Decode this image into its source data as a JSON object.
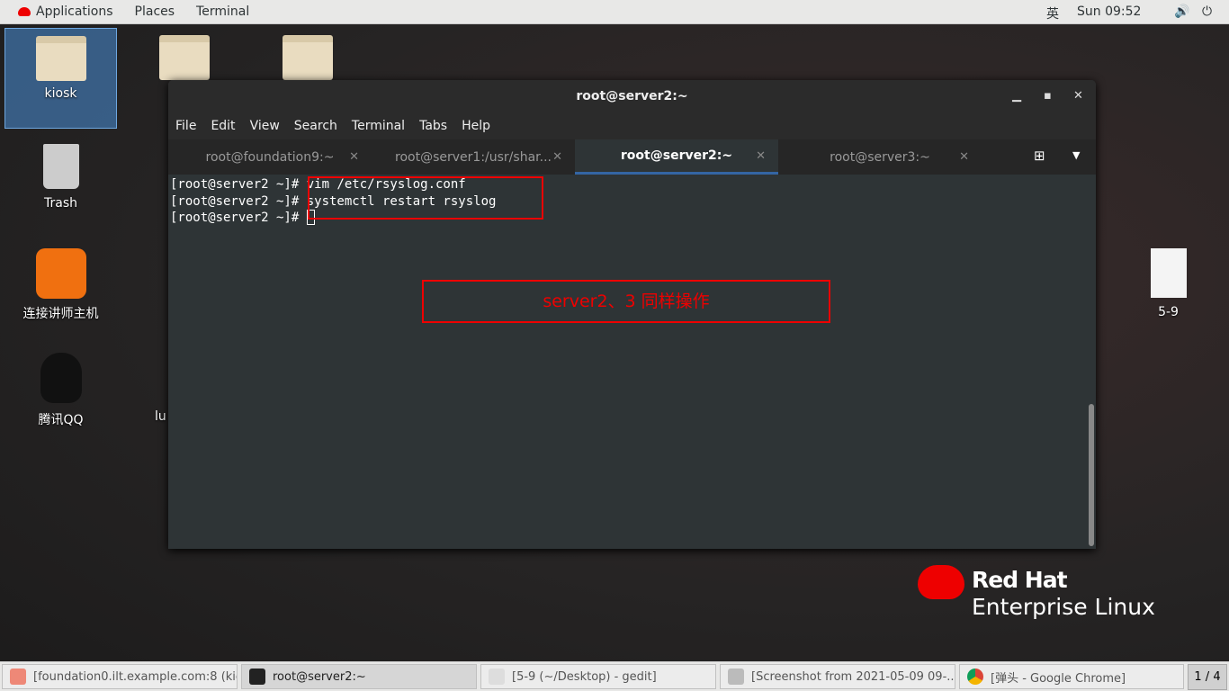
{
  "topbar": {
    "applications": "Applications",
    "places": "Places",
    "terminal": "Terminal",
    "input_method": "英",
    "clock": "Sun 09:52"
  },
  "desktop": {
    "icons": [
      {
        "label": "kiosk"
      },
      {
        "label": "Trash"
      },
      {
        "label": "连接讲师主机"
      },
      {
        "label": "腾讯QQ"
      },
      {
        "label": "lu"
      },
      {
        "label": "5-9"
      }
    ]
  },
  "window": {
    "title": "root@server2:~",
    "menu": [
      "File",
      "Edit",
      "View",
      "Search",
      "Terminal",
      "Tabs",
      "Help"
    ],
    "tabs": [
      {
        "label": "root@foundation9:~"
      },
      {
        "label": "root@server1:/usr/shar..."
      },
      {
        "label": "root@server2:~",
        "active": true
      },
      {
        "label": "root@server3:~"
      }
    ],
    "lines": [
      "[root@server2 ~]# vim /etc/rsyslog.conf",
      "[root@server2 ~]# systemctl restart rsyslog",
      "[root@server2 ~]# "
    ]
  },
  "annotation": "server2、3 同样操作",
  "logo": {
    "line1": "Red Hat",
    "line2": "Enterprise Linux"
  },
  "taskbar": {
    "items": [
      {
        "label": "[foundation0.ilt.example.com:8 (kio..."
      },
      {
        "label": "root@server2:~",
        "active": true
      },
      {
        "label": "[5-9 (~/Desktop) - gedit]"
      },
      {
        "label": "[Screenshot from 2021-05-09 09-..."
      },
      {
        "label": "[弹头 - Google Chrome]"
      }
    ],
    "pager": "1 / 4"
  },
  "colors": {
    "accent": "#3465a4",
    "annotation": "#ee0000"
  }
}
